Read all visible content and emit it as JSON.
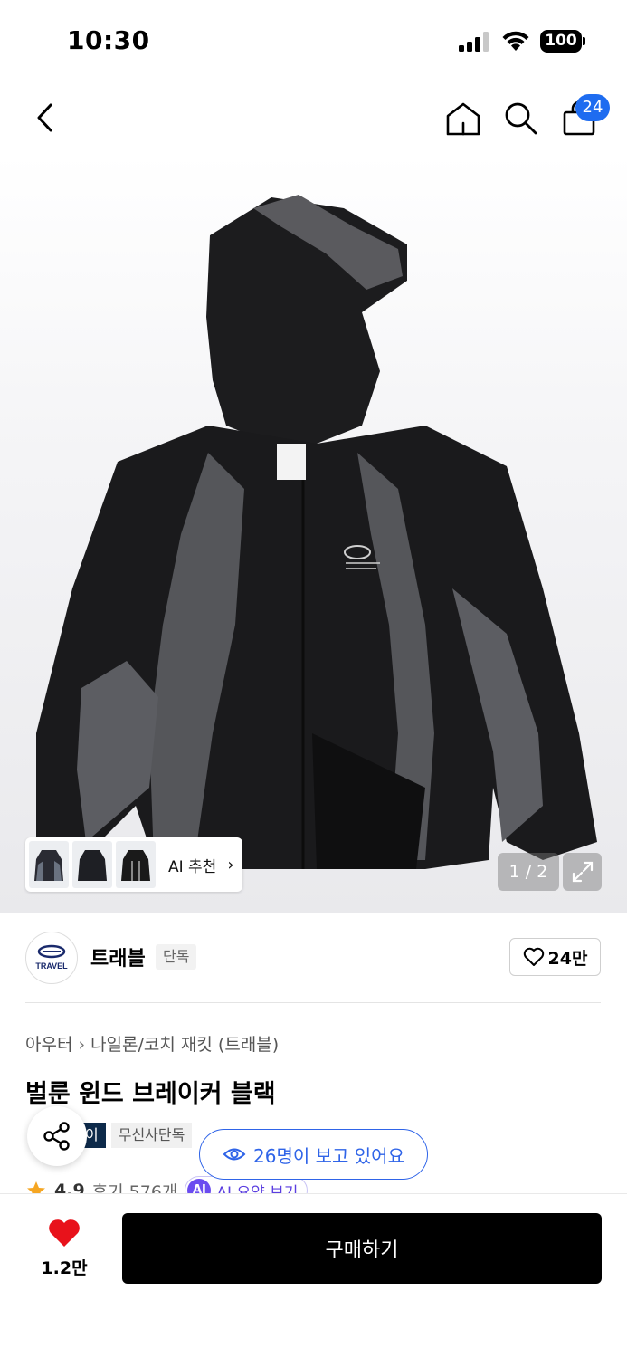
{
  "status_bar": {
    "time": "10:30",
    "battery": "100"
  },
  "nav": {
    "cart_count": "24"
  },
  "gallery": {
    "ai_recommend_label": "AI 추천",
    "page_indicator": "1 / 2"
  },
  "brand": {
    "name": "트래블",
    "tag": "단독",
    "logo_text": "TRAVEL",
    "like_count": "24만"
  },
  "product": {
    "breadcrumb": [
      "아우터",
      "나일론/코치 재킷 (트래블)"
    ],
    "title": "벌룬 윈드 브레이커 블랙",
    "tags": [
      "이",
      "무신사단독"
    ],
    "rating": "4.9",
    "reviews": "후기 576개",
    "ai_summary_badge": "AI",
    "ai_summary_label": "AI 요약 보기"
  },
  "viewers": {
    "text": "26명이 보고 있어요"
  },
  "bottom_bar": {
    "favorite_count": "1.2만",
    "buy_label": "구매하기"
  },
  "colors": {
    "accent_blue": "#2f64e8",
    "badge_blue": "#1e6cf0",
    "heart_red": "#e8121b",
    "buy_button": "#000000"
  }
}
